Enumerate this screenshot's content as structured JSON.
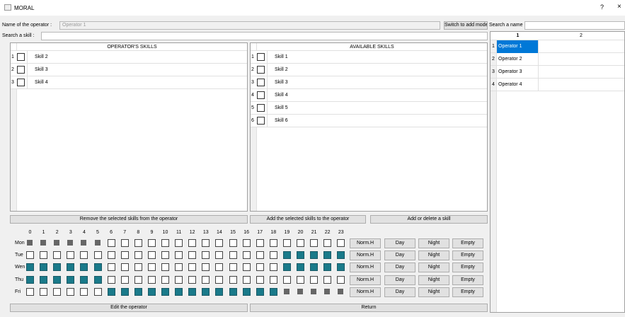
{
  "window": {
    "title": "MORAL",
    "help": "?",
    "close": "×"
  },
  "operator": {
    "label": "Name of the operator :",
    "value": "Operator 1",
    "switch_btn": "Switch to add mode"
  },
  "skill_search": {
    "label": "Search a skill :",
    "value": ""
  },
  "operator_skills": {
    "header": "OPERATOR'S SKILLS",
    "rows": [
      {
        "num": "1",
        "name": "Skill 2"
      },
      {
        "num": "2",
        "name": "Skill 3"
      },
      {
        "num": "3",
        "name": "Skill 4"
      }
    ]
  },
  "available_skills": {
    "header": "AVAILABLE SKILLS",
    "rows": [
      {
        "num": "1",
        "name": "Skill 1"
      },
      {
        "num": "2",
        "name": "Skill 2"
      },
      {
        "num": "3",
        "name": "Skill 3"
      },
      {
        "num": "4",
        "name": "Skill 4"
      },
      {
        "num": "5",
        "name": "Skill 5"
      },
      {
        "num": "6",
        "name": "Skill 6"
      }
    ]
  },
  "buttons": {
    "remove_skills": "Remove the selected skills from the operator",
    "add_skills": "Add the selected skills to the operator",
    "add_delete_skill": "Add or delete a skill",
    "edit_operator": "Edit the operator",
    "return": "Return"
  },
  "schedule": {
    "hours": [
      "0",
      "1",
      "2",
      "3",
      "4",
      "5",
      "6",
      "7",
      "8",
      "9",
      "10",
      "11",
      "12",
      "13",
      "14",
      "15",
      "16",
      "17",
      "18",
      "19",
      "20",
      "21",
      "22",
      "23"
    ],
    "row_buttons": [
      "Norm.H",
      "Day",
      "Night",
      "Empty"
    ],
    "days": [
      {
        "label": "Mon",
        "cells": [
          "G",
          "G",
          "G",
          "G",
          "G",
          "G",
          "W",
          "W",
          "W",
          "W",
          "W",
          "W",
          "W",
          "W",
          "W",
          "W",
          "W",
          "W",
          "W",
          "W",
          "W",
          "W",
          "W",
          "W"
        ]
      },
      {
        "label": "Tue",
        "cells": [
          "W",
          "W",
          "W",
          "W",
          "W",
          "W",
          "W",
          "W",
          "W",
          "W",
          "W",
          "W",
          "W",
          "W",
          "W",
          "W",
          "W",
          "W",
          "W",
          "T",
          "T",
          "T",
          "T",
          "T"
        ]
      },
      {
        "label": "Wen",
        "cells": [
          "T",
          "T",
          "T",
          "T",
          "T",
          "T",
          "W",
          "W",
          "W",
          "W",
          "W",
          "W",
          "W",
          "W",
          "W",
          "W",
          "W",
          "W",
          "W",
          "T",
          "T",
          "T",
          "T",
          "T"
        ]
      },
      {
        "label": "Thu",
        "cells": [
          "T",
          "T",
          "T",
          "T",
          "T",
          "T",
          "W",
          "W",
          "W",
          "W",
          "W",
          "W",
          "W",
          "W",
          "W",
          "W",
          "W",
          "W",
          "W",
          "W",
          "W",
          "W",
          "W",
          "W"
        ]
      },
      {
        "label": "Fri",
        "cells": [
          "W",
          "W",
          "W",
          "W",
          "W",
          "W",
          "T",
          "T",
          "T",
          "T",
          "T",
          "T",
          "T",
          "T",
          "T",
          "T",
          "T",
          "T",
          "T",
          "G",
          "G",
          "G",
          "G",
          "G"
        ]
      }
    ]
  },
  "operators": {
    "search_label": "Search a name :",
    "search_value": "",
    "col1": "1",
    "col2": "2",
    "rows": [
      {
        "num": "1",
        "name": "Operator 1",
        "selected": true
      },
      {
        "num": "2",
        "name": "Operator 2"
      },
      {
        "num": "3",
        "name": "Operator 3"
      },
      {
        "num": "4",
        "name": "Operator 4"
      }
    ]
  },
  "colors": {
    "teal": "#1a7a8a",
    "selection": "#0078d7"
  }
}
